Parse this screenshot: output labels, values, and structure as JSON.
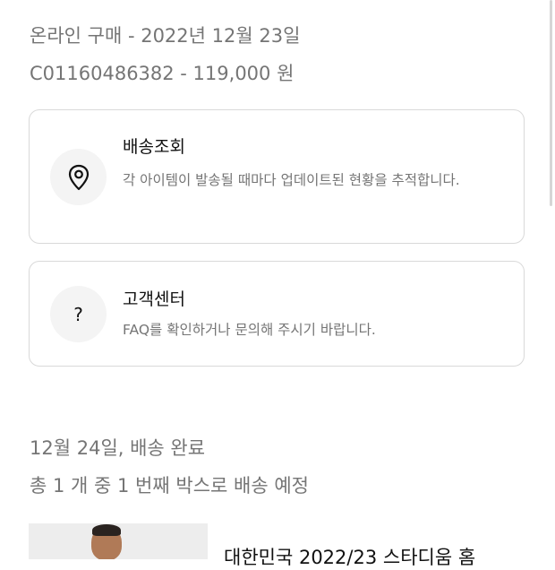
{
  "order": {
    "purchase_line": "온라인 구매 - 2022년 12월 23일",
    "order_line": "C01160486382 - 119,000 원"
  },
  "tracking_card": {
    "icon": "location-pin-icon",
    "title": "배송조회",
    "description": "각 아이템이 발송될 때마다 업데이트된 현황을 추적합니다."
  },
  "support_card": {
    "icon": "question-mark-icon",
    "icon_glyph": "?",
    "title": "고객센터",
    "description": "FAQ를 확인하거나 문의해 주시기 바랍니다."
  },
  "delivery": {
    "status": "12월 24일, 배송 완료",
    "box_info": "총 1 개 중 1 번째 박스로 배송 예정"
  },
  "product": {
    "title": "대한민국 2022/23 스타디움 홈"
  },
  "colors": {
    "text_primary": "#111111",
    "text_secondary": "#757575",
    "card_border": "#d9d9d9",
    "icon_background": "#f4f4f4"
  }
}
